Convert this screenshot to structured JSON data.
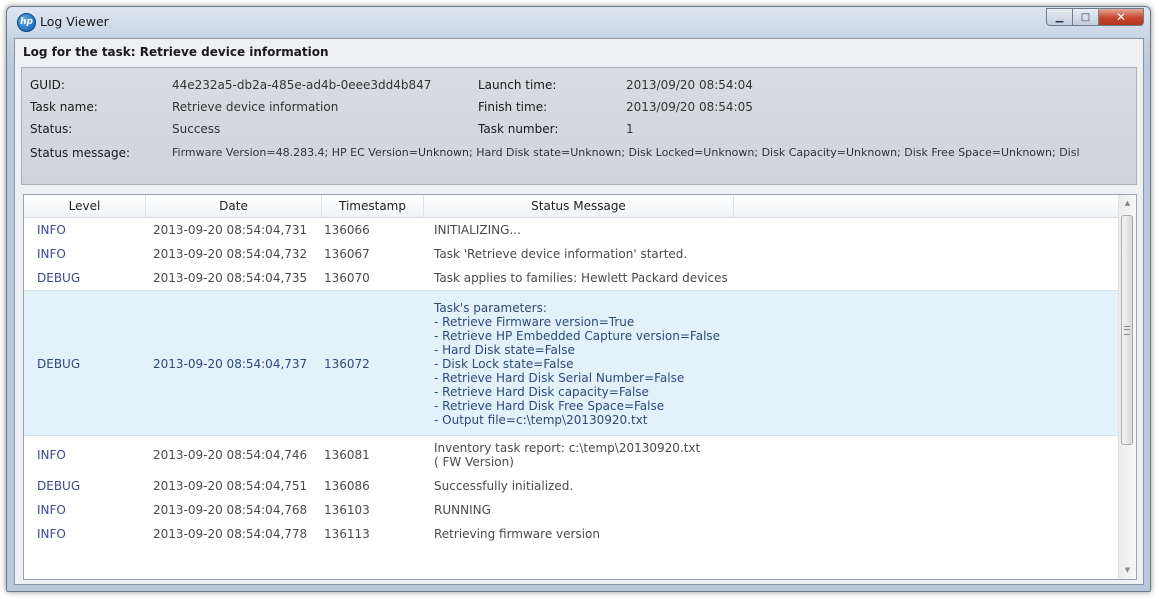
{
  "window": {
    "title": "Log Viewer",
    "icon": "hp-logo-icon",
    "icon_text": "hp",
    "controls": {
      "minimize": "▁",
      "maximize": "□",
      "close": "✕"
    }
  },
  "task_header": "Log for the task: Retrieve device information",
  "info": {
    "guid_label": "GUID:",
    "guid_value": "44e232a5-db2a-485e-ad4b-0eee3dd4b847",
    "task_name_label": "Task name:",
    "task_name_value": "Retrieve device information",
    "status_label": "Status:",
    "status_value": "Success",
    "status_message_label": "Status message:",
    "status_message_value": "Firmware Version=48.283.4; HP EC Version=Unknown; Hard Disk state=Unknown; Disk Locked=Unknown; Disk Capacity=Unknown; Disk Free Space=Unknown; Disl",
    "launch_time_label": "Launch time:",
    "launch_time_value": "2013/09/20 08:54:04",
    "finish_time_label": "Finish time:",
    "finish_time_value": "2013/09/20 08:54:05",
    "task_number_label": "Task number:",
    "task_number_value": "1"
  },
  "grid": {
    "columns": [
      "Level",
      "Date",
      "Timestamp",
      "Status Message"
    ],
    "rows": [
      {
        "level": "INFO",
        "date": "2013-09-20 08:54:04,731",
        "timestamp": "136066",
        "message": [
          "INITIALIZING..."
        ]
      },
      {
        "level": "INFO",
        "date": "2013-09-20 08:54:04,732",
        "timestamp": "136067",
        "message": [
          "Task 'Retrieve device information' started."
        ]
      },
      {
        "level": "DEBUG",
        "date": "2013-09-20 08:54:04,735",
        "timestamp": "136070",
        "message": [
          "Task applies to families: Hewlett Packard devices"
        ]
      },
      {
        "level": "DEBUG",
        "date": "2013-09-20 08:54:04,737",
        "timestamp": "136072",
        "selected": true,
        "message": [
          "Task's parameters:",
          "- Retrieve Firmware version=True",
          "- Retrieve HP Embedded Capture version=False",
          "- Hard Disk state=False",
          "- Disk Lock state=False",
          "- Retrieve Hard Disk Serial Number=False",
          "- Retrieve Hard Disk capacity=False",
          "- Retrieve Hard Disk Free Space=False",
          "- Output file=c:\\temp\\20130920.txt"
        ]
      },
      {
        "level": "INFO",
        "date": "2013-09-20 08:54:04,746",
        "timestamp": "136081",
        "message": [
          "Inventory task report: c:\\temp\\20130920.txt",
          "( FW Version)"
        ]
      },
      {
        "level": "DEBUG",
        "date": "2013-09-20 08:54:04,751",
        "timestamp": "136086",
        "message": [
          "Successfully initialized."
        ]
      },
      {
        "level": "INFO",
        "date": "2013-09-20 08:54:04,768",
        "timestamp": "136103",
        "message": [
          "RUNNING"
        ]
      },
      {
        "level": "INFO",
        "date": "2013-09-20 08:54:04,778",
        "timestamp": "136113",
        "message": [
          "Retrieving firmware version"
        ]
      }
    ]
  },
  "scrollbar": {
    "up_glyph": "▲",
    "down_glyph": "▼"
  },
  "colors": {
    "level_text": "#3a4a8a",
    "selected_row": "#e3f1fb",
    "info_panel": "#d3d8de",
    "close_button": "#c7452e"
  }
}
